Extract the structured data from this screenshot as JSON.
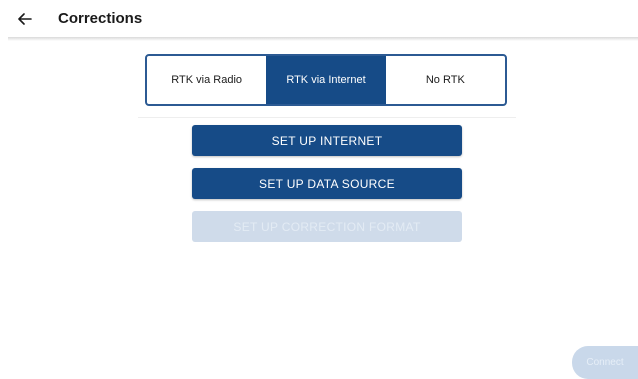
{
  "header": {
    "title": "Corrections",
    "back_icon": "arrow-left-icon"
  },
  "mode_selector": {
    "options": [
      "RTK via Radio",
      "RTK via Internet",
      "No RTK"
    ],
    "selected": "RTK via Internet"
  },
  "actions": {
    "setup_internet_label": "SET UP INTERNET",
    "setup_data_source_label": "SET UP DATA SOURCE",
    "setup_correction_format_label": "SET UP CORRECTION FORMAT",
    "setup_correction_format_enabled": false
  },
  "footer": {
    "connect_label": "Connect",
    "connect_enabled": false
  },
  "colors": {
    "primary": "#164b87",
    "primary_border": "#2c5a93",
    "disabled": "#cfdbea"
  }
}
